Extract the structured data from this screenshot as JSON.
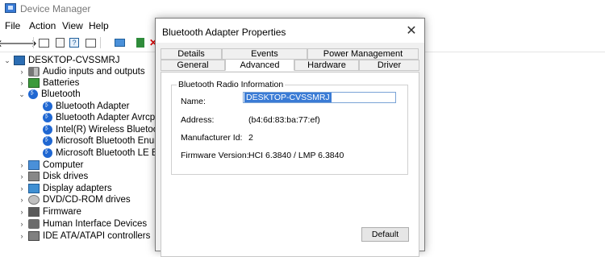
{
  "window": {
    "title": "Device Manager"
  },
  "menu": [
    "File",
    "Action",
    "View",
    "Help"
  ],
  "tree": {
    "root": "DESKTOP-CVSSMRJ",
    "items": [
      {
        "label": "Audio inputs and outputs",
        "icon": "speaker-icon"
      },
      {
        "label": "Batteries",
        "icon": "battery-icon"
      },
      {
        "label": "Bluetooth",
        "icon": "bluetooth-icon"
      },
      {
        "label": "Bluetooth Adapter",
        "icon": "bluetooth-icon"
      },
      {
        "label": "Bluetooth Adapter  Avrcp Tran",
        "icon": "bluetooth-icon"
      },
      {
        "label": "Intel(R) Wireless Bluetooth(R)",
        "icon": "bluetooth-icon"
      },
      {
        "label": "Microsoft Bluetooth Enumera",
        "icon": "bluetooth-icon"
      },
      {
        "label": "Microsoft Bluetooth LE Enum",
        "icon": "bluetooth-icon"
      },
      {
        "label": "Computer",
        "icon": "monitor-icon"
      },
      {
        "label": "Disk drives",
        "icon": "disk-icon"
      },
      {
        "label": "Display adapters",
        "icon": "display-adapter-icon"
      },
      {
        "label": "DVD/CD-ROM drives",
        "icon": "dvd-icon"
      },
      {
        "label": "Firmware",
        "icon": "firmware-icon"
      },
      {
        "label": "Human Interface Devices",
        "icon": "hid-icon"
      },
      {
        "label": "IDE ATA/ATAPI controllers",
        "icon": "ide-icon"
      }
    ]
  },
  "dialog": {
    "title": "Bluetooth Adapter  Properties",
    "tabs_top": [
      "Details",
      "Events",
      "Power Management"
    ],
    "tabs_bottom": [
      "General",
      "Advanced",
      "Hardware",
      "Driver"
    ],
    "active_tab": "Advanced",
    "group_title": "Bluetooth Radio Information",
    "fields": {
      "name_label": "Name:",
      "name_value": "DESKTOP-CVSSMRJ",
      "address_label": "Address:",
      "address_value": "(b4:6d:83:ba:77:ef)",
      "manufacturer_label": "Manufacturer Id:",
      "manufacturer_value": "2",
      "firmware_label": "Firmware Version:",
      "firmware_value": "HCI 6.3840  /  LMP 6.3840"
    },
    "default_button": "Default"
  }
}
